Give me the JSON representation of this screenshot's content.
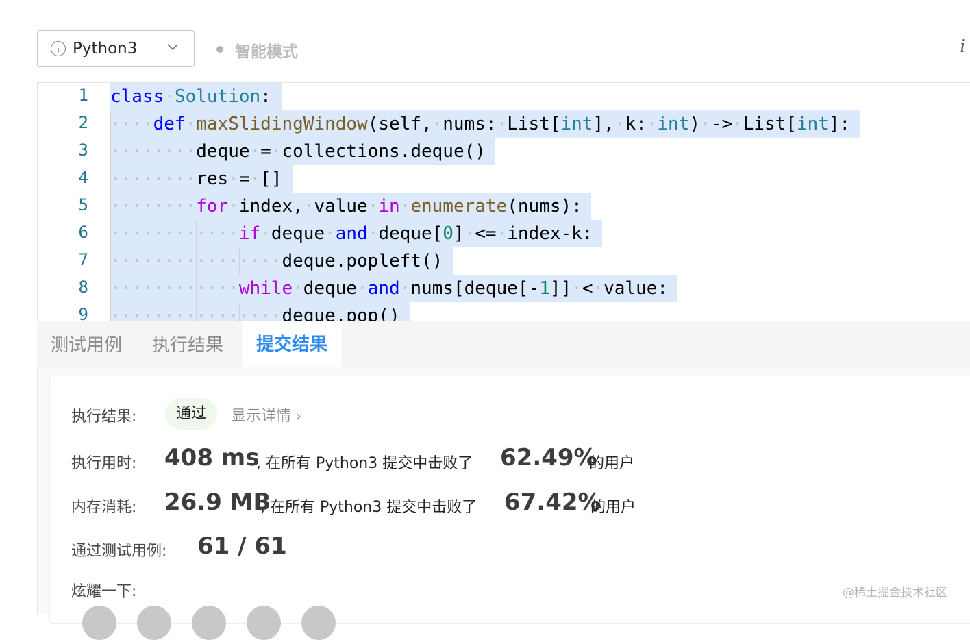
{
  "toolbar": {
    "language": "Python3",
    "mode_label": "智能模式",
    "right_icon": "i"
  },
  "editor": {
    "lines": [
      {
        "num": "1"
      },
      {
        "num": "2"
      },
      {
        "num": "3"
      },
      {
        "num": "4"
      },
      {
        "num": "5"
      },
      {
        "num": "6"
      },
      {
        "num": "7"
      },
      {
        "num": "8"
      },
      {
        "num": "9"
      }
    ],
    "code": [
      "class Solution:",
      "    def maxSlidingWindow(self, nums: List[int], k: int) -> List[int]:",
      "        deque = collections.deque()",
      "        res = []",
      "        for index, value in enumerate(nums):",
      "            if deque and deque[0] <= index-k:",
      "                deque.popleft()",
      "            while deque and nums[deque[-1]] < value:",
      "                deque.pop()"
    ]
  },
  "tabs": {
    "test_cases": "测试用例",
    "run_result": "执行结果",
    "submit_result": "提交结果"
  },
  "result": {
    "status_label": "执行结果:",
    "status_value": "通过",
    "details_link": "显示详情",
    "details_arrow": "›",
    "runtime_label": "执行用时:",
    "runtime_value": "408 ms",
    "runtime_text": ", 在所有 Python3 提交中击败了",
    "runtime_percent": "62.49%",
    "runtime_suffix": "的用户",
    "memory_label": "内存消耗:",
    "memory_value": "26.9 MB",
    "memory_text": ", 在所有 Python3 提交中击败了",
    "memory_percent": "67.42%",
    "memory_suffix": "的用户",
    "cases_label": "通过测试用例:",
    "cases_value": "61 / 61",
    "share_label": "炫耀一下:"
  },
  "watermark": "@稀土掘金技术社区",
  "colors": {
    "selection": "#dbe9fb",
    "keyword": "#0000ff",
    "control": "#af00db",
    "class_name": "#267f99",
    "function": "#795e26",
    "number": "#098658",
    "active_tab": "#2d8cf0"
  }
}
